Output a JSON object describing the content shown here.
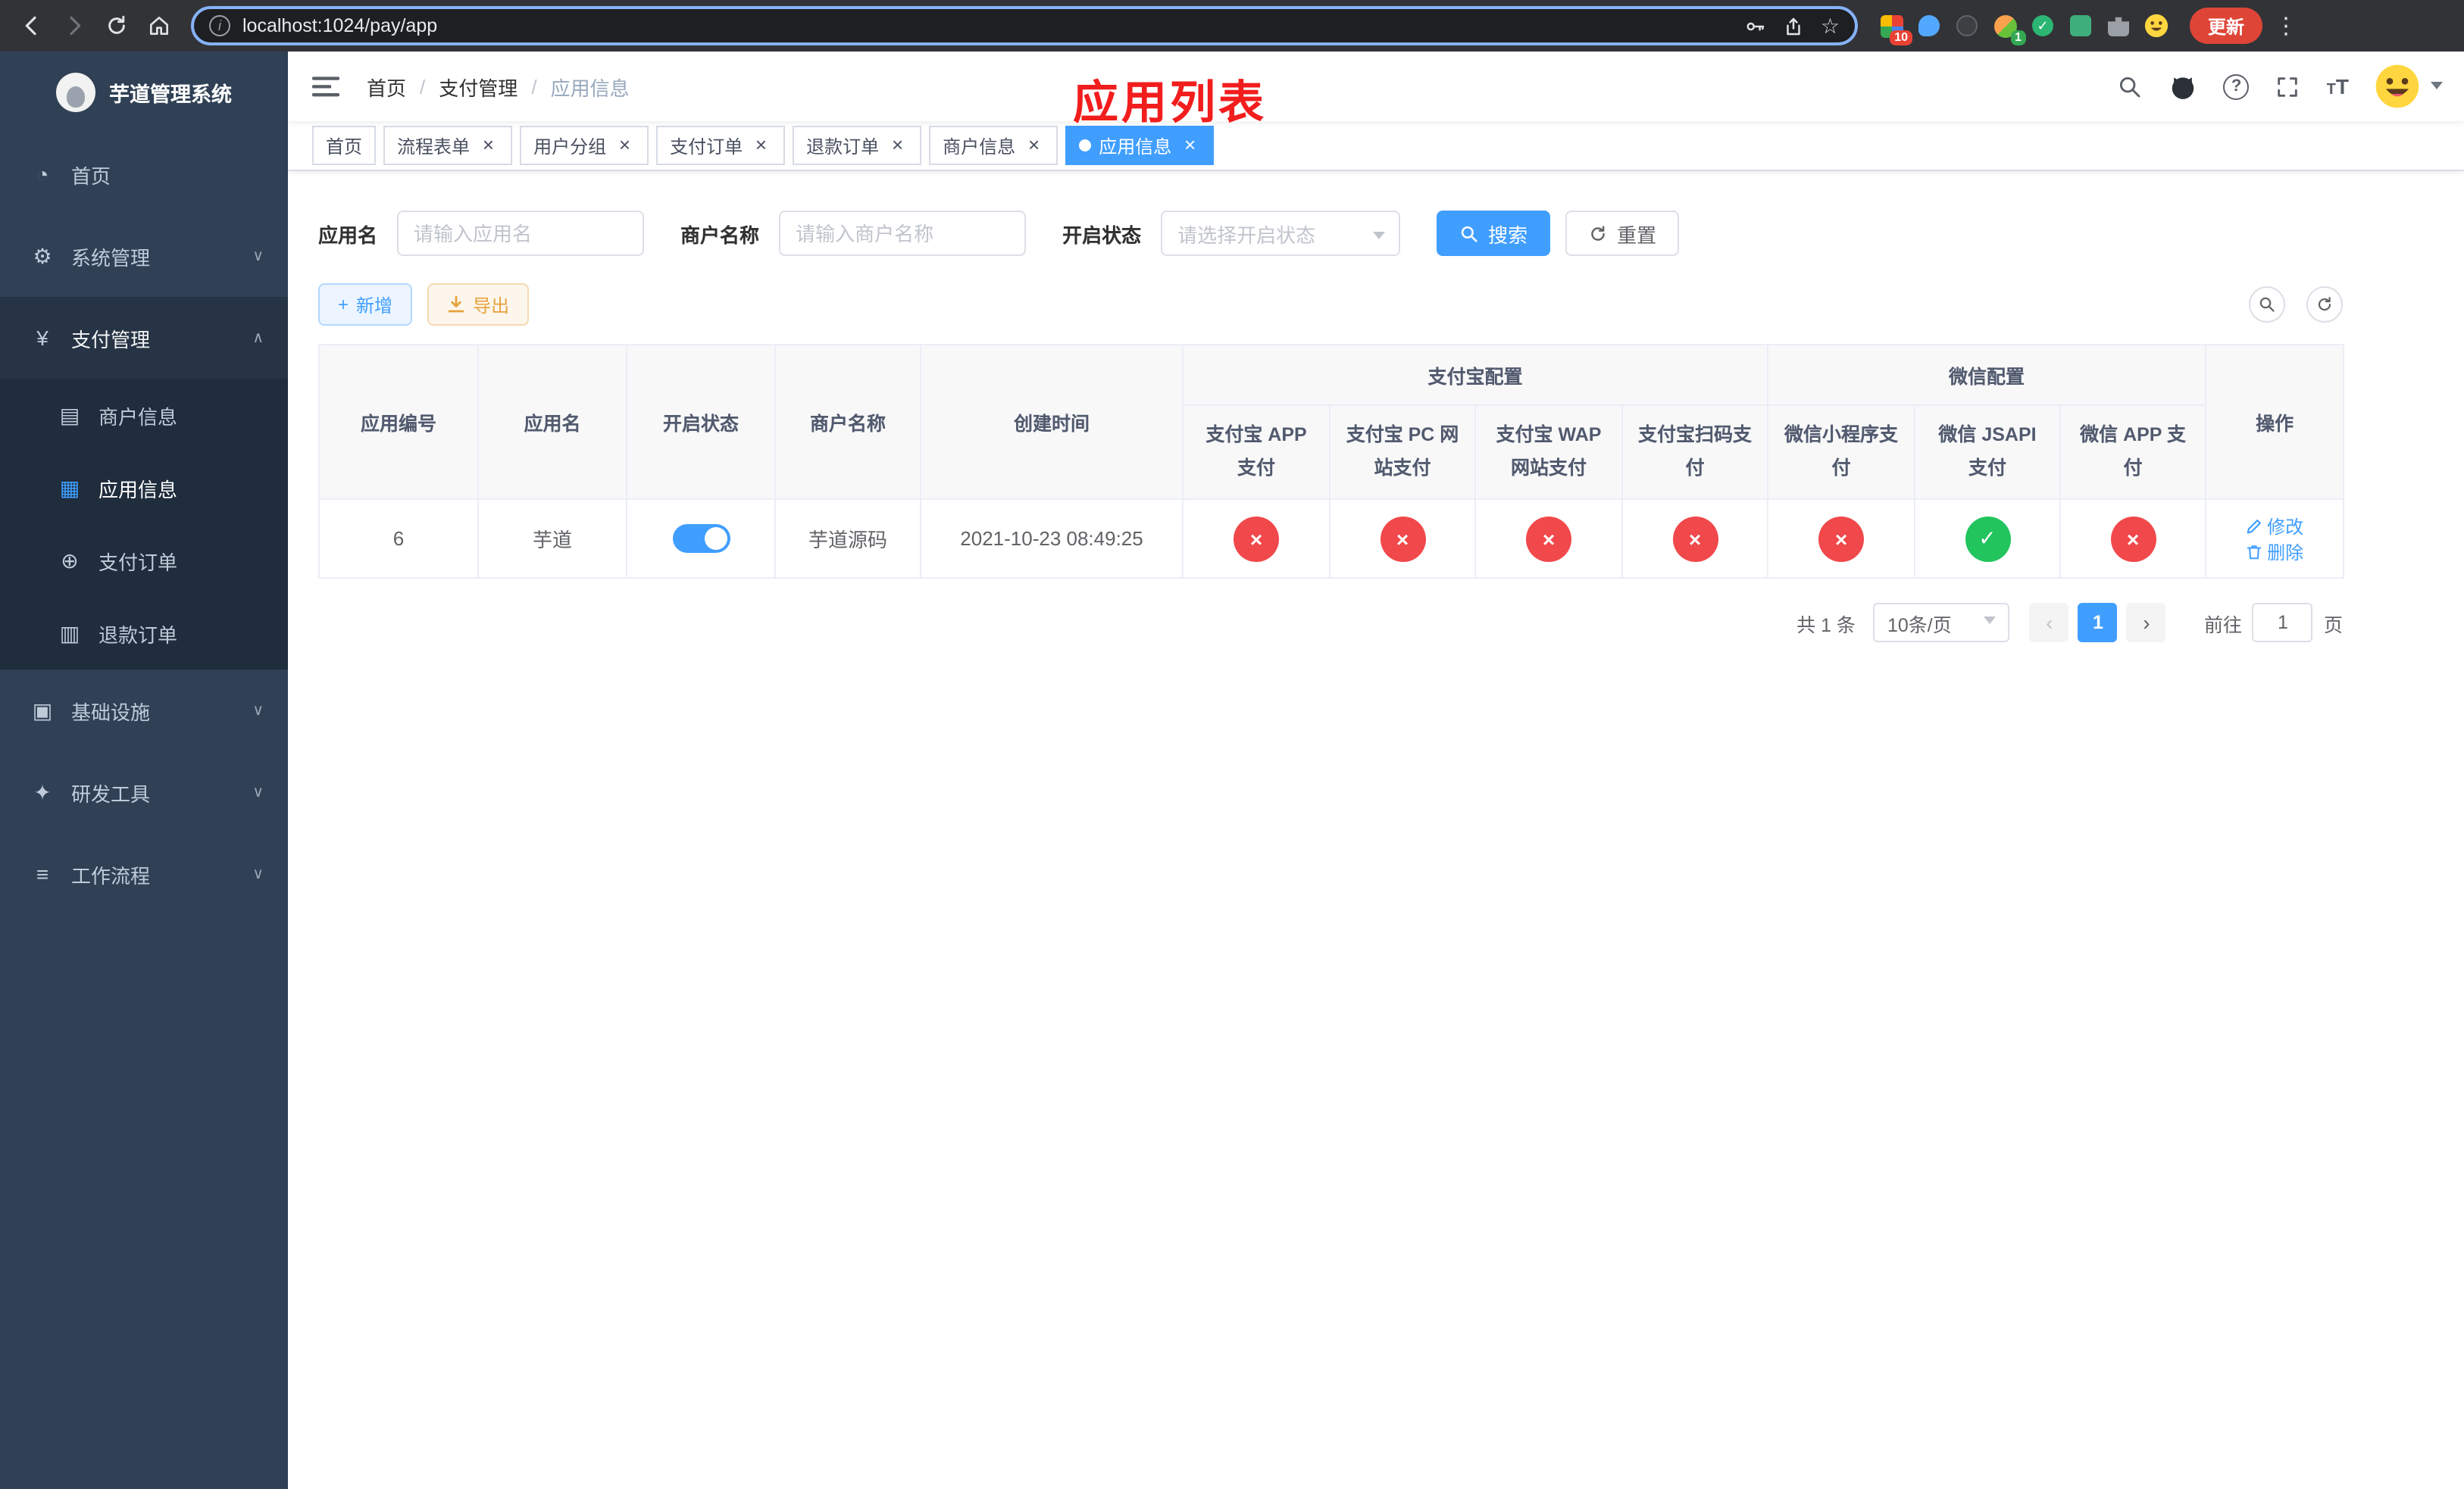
{
  "browser": {
    "url": "localhost:1024/pay/app",
    "update_label": "更新",
    "ext_badge_red": "10",
    "ext_badge_green": "1"
  },
  "colors": {
    "accent": "#409eff",
    "danger": "#f0484b",
    "success": "#21c45d",
    "warning": "#e6a23c",
    "annotation_red": "#f21d1d",
    "sidebar_bg": "#304156",
    "submenu_bg": "#1f2d3d"
  },
  "icons": {
    "dashboard": "◔",
    "system": "⚙",
    "payment": "¥",
    "merchant": "▤",
    "app": "▦",
    "order": "⊕",
    "refund": "▥",
    "infra": "▣",
    "devtools": "✦",
    "workflow": "≡",
    "chevron_down": "∨",
    "chevron_up": "∧",
    "check": "✓",
    "cross": "×",
    "star": "☆",
    "dots": "⋮",
    "info": "i"
  },
  "sidebar": {
    "title": "芋道管理系统",
    "items": [
      {
        "label": "首页"
      },
      {
        "label": "系统管理"
      },
      {
        "label": "支付管理"
      },
      {
        "label": "商户信息"
      },
      {
        "label": "应用信息"
      },
      {
        "label": "支付订单"
      },
      {
        "label": "退款订单"
      },
      {
        "label": "基础设施"
      },
      {
        "label": "研发工具"
      },
      {
        "label": "工作流程"
      }
    ]
  },
  "navbar": {
    "breadcrumb": [
      "首页",
      "支付管理",
      "应用信息"
    ],
    "annotation": "应用列表"
  },
  "tabs": [
    {
      "label": "首页",
      "closable": false,
      "active": false
    },
    {
      "label": "流程表单",
      "closable": true,
      "active": false
    },
    {
      "label": "用户分组",
      "closable": true,
      "active": false
    },
    {
      "label": "支付订单",
      "closable": true,
      "active": false
    },
    {
      "label": "退款订单",
      "closable": true,
      "active": false
    },
    {
      "label": "商户信息",
      "closable": true,
      "active": false
    },
    {
      "label": "应用信息",
      "closable": true,
      "active": true
    }
  ],
  "filters": {
    "app_name_label": "应用名",
    "app_name_placeholder": "请输入应用名",
    "merchant_label": "商户名称",
    "merchant_placeholder": "请输入商户名称",
    "status_label": "开启状态",
    "status_placeholder": "请选择开启状态",
    "search_label": "搜索",
    "reset_label": "重置"
  },
  "actions": {
    "add_label": "新增",
    "export_label": "导出"
  },
  "table": {
    "groups": {
      "alipay": "支付宝配置",
      "wechat": "微信配置"
    },
    "columns": {
      "app_id": "应用编号",
      "app_name": "应用名",
      "status": "开启状态",
      "merchant": "商户名称",
      "create_time": "创建时间",
      "alipay_app": "支付宝 APP 支付",
      "alipay_pc": "支付宝 PC 网站支付",
      "alipay_wap": "支付宝 WAP 网站支付",
      "alipay_qr": "支付宝扫码支付",
      "wx_lite": "微信小程序支付",
      "wx_jsapi": "微信 JSAPI 支付",
      "wx_app": "微信 APP 支付",
      "op": "操作"
    },
    "op_labels": {
      "edit": "修改",
      "delete": "删除"
    },
    "rows": [
      {
        "app_id": "6",
        "app_name": "芋道",
        "status_on": true,
        "merchant": "芋道源码",
        "create_time": "2021-10-23 08:49:25",
        "alipay_app": false,
        "alipay_pc": false,
        "alipay_wap": false,
        "alipay_qr": false,
        "wx_lite": false,
        "wx_jsapi": true,
        "wx_app": false
      }
    ]
  },
  "pagination": {
    "total_text": "共 1 条",
    "page_size": "10条/页",
    "prev": "‹",
    "next": "›",
    "current_page": "1",
    "goto_label": "前往",
    "goto_value": "1",
    "page_unit": "页"
  }
}
